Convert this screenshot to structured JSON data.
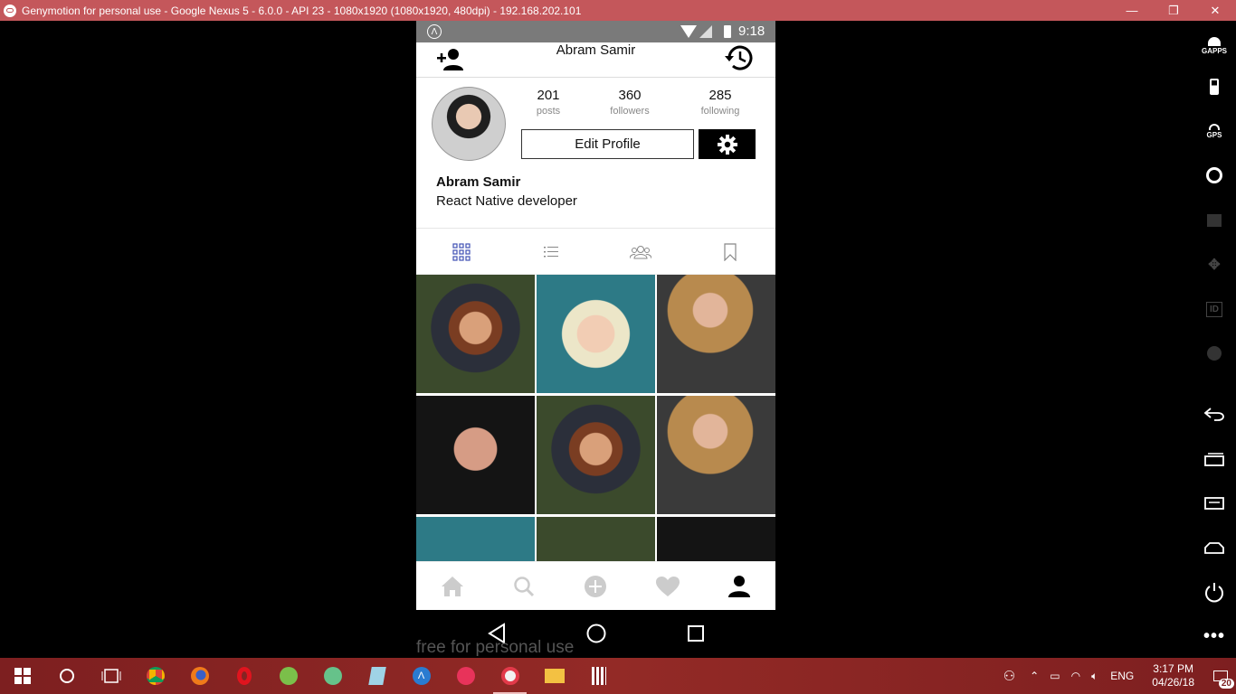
{
  "window": {
    "title": "Genymotion for personal use - Google Nexus 5 - 6.0.0 - API 23 - 1080x1920 (1080x1920, 480dpi) - 192.168.202.101",
    "minimize": "—",
    "restore": "❐",
    "close": "✕"
  },
  "statusbar": {
    "time": "9:18",
    "badge": "Λ"
  },
  "topnav": {
    "username": "Abram Samir"
  },
  "profile": {
    "stats": [
      {
        "value": "201",
        "label": "posts"
      },
      {
        "value": "360",
        "label": "followers"
      },
      {
        "value": "285",
        "label": "following"
      }
    ],
    "edit_label": "Edit Profile",
    "name": "Abram Samir",
    "bio": "React Native developer"
  },
  "tabs": [
    "grid-icon",
    "list-icon",
    "people-icon",
    "bookmark-icon"
  ],
  "bottom_nav": [
    "home-icon",
    "search-icon",
    "add-icon",
    "heart-icon",
    "profile-icon"
  ],
  "colors": {
    "active_tab": "#3f51b5",
    "title_bar": "#c4575b",
    "taskbar": "#8b2522"
  },
  "watermark": "free for personal use",
  "sidebar": {
    "gapps": "GAPPS",
    "gps": "GPS",
    "id": "ID"
  },
  "taskbar": {
    "language": "ENG",
    "time": "3:17 PM",
    "date": "04/26/18",
    "notifications": "20"
  }
}
